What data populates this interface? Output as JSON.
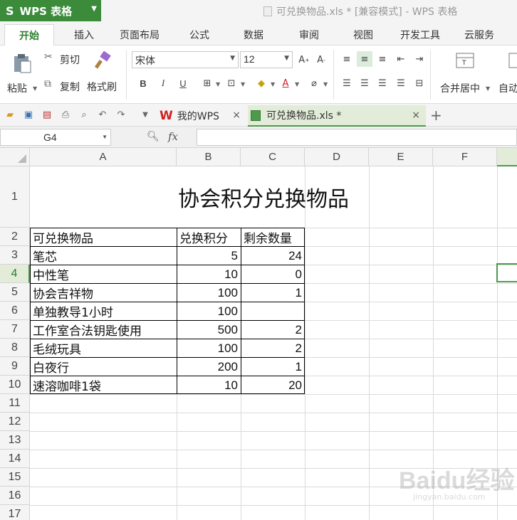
{
  "app": {
    "name": "WPS 表格",
    "logo": "S",
    "window_title": "可兑换物品.xls * [兼容模式] - WPS 表格"
  },
  "ribbon_tabs": [
    "开始",
    "插入",
    "页面布局",
    "公式",
    "数据",
    "审阅",
    "视图",
    "开发工具",
    "云服务"
  ],
  "ribbon": {
    "paste": "粘贴",
    "cut": "剪切",
    "copy": "复制",
    "format_painter": "格式刷",
    "font_name": "宋体",
    "font_size": "12",
    "bold": "B",
    "italic": "I",
    "underline": "U",
    "merge_center": "合并居中",
    "auto_wrap": "自动"
  },
  "doc_tabs": [
    {
      "label": "我的WPS"
    },
    {
      "label": "可兑换物品.xls *"
    }
  ],
  "formula_bar": {
    "cell_ref": "G4",
    "fx": "fx",
    "value": ""
  },
  "columns": [
    "A",
    "B",
    "C",
    "D",
    "E",
    "F"
  ],
  "rows": [
    "1",
    "2",
    "3",
    "4",
    "5",
    "6",
    "7",
    "8",
    "9",
    "10",
    "11",
    "12",
    "13",
    "14",
    "15",
    "16",
    "17"
  ],
  "sheet": {
    "title": "协会积分兑换物品",
    "headers": [
      "可兑换物品",
      "兑换积分",
      "剩余数量"
    ],
    "records": [
      {
        "item": "笔芯",
        "points": "5",
        "qty": "24"
      },
      {
        "item": "中性笔",
        "points": "10",
        "qty": "0"
      },
      {
        "item": "协会吉祥物",
        "points": "100",
        "qty": "1"
      },
      {
        "item": "单独教导1小时",
        "points": "100",
        "qty": ""
      },
      {
        "item": "工作室合法钥匙使用",
        "points": "500",
        "qty": "2"
      },
      {
        "item": "毛绒玩具",
        "points": "100",
        "qty": "2"
      },
      {
        "item": "白夜行",
        "points": "200",
        "qty": "1"
      },
      {
        "item": "速溶咖啡1袋",
        "points": "10",
        "qty": "20"
      }
    ]
  },
  "watermark": {
    "brand": "Baidu经验",
    "sub": "jingyan.baidu.com"
  },
  "colors": {
    "accent": "#3b8b3b",
    "selection": "#4d9a4d"
  }
}
